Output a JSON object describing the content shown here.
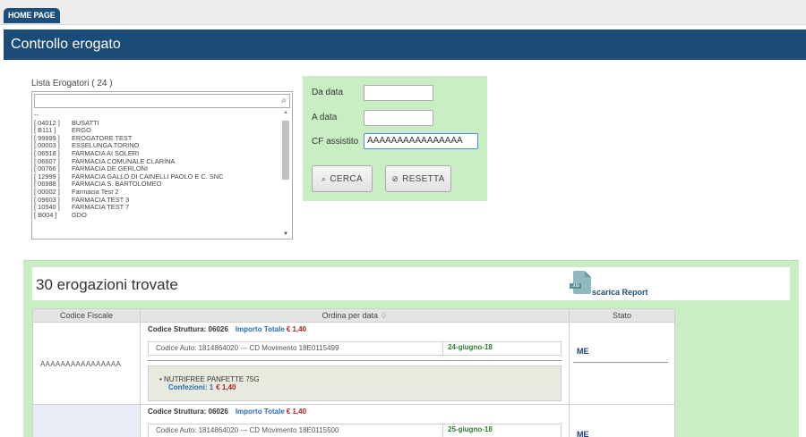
{
  "nav": {
    "home_tab": "HOME PAGE"
  },
  "page": {
    "title": "Controllo erogato"
  },
  "lista": {
    "label": "Lista Erogatori ( 24 )",
    "search_value": "",
    "items": [
      {
        "code": "--",
        "name": ""
      },
      {
        "code": "[ 04012 ]",
        "name": "BUSATTI"
      },
      {
        "code": "[ B111 ]",
        "name": "ERGO"
      },
      {
        "code": "[ 99999 ]",
        "name": "EROGATORE TEST"
      },
      {
        "code": "[ 00003 ]",
        "name": "ESSELUNGA TORINO"
      },
      {
        "code": "[ 06518 ]",
        "name": "FARMACIA AI SOLERI"
      },
      {
        "code": "[ 06607 ]",
        "name": "FARMACIA COMUNALE CLARINA"
      },
      {
        "code": "[ 00766 ]",
        "name": "FARMACIA DE GERLONI"
      },
      {
        "code": "[ 12999 ]",
        "name": "FARMACIA GALLO DI CAINELLI PAOLO E C. SNC"
      },
      {
        "code": "[ 06988 ]",
        "name": "FARMACIA S. BARTOLOMEO"
      },
      {
        "code": "[ 00002 ]",
        "name": "Farmacia Test 2"
      },
      {
        "code": "[ 09603 ]",
        "name": "FARMACIA TEST 3"
      },
      {
        "code": "[ 10540 ]",
        "name": "FARMACIA TEST 7"
      },
      {
        "code": "[ B004 ]",
        "name": "GDO"
      }
    ]
  },
  "filters": {
    "da_data_label": "Da data",
    "da_data_value": "",
    "a_data_label": "A data",
    "a_data_value": "",
    "cf_label": "CF assistito",
    "cf_value": "AAAAAAAAAAAAAAAA",
    "cerca_label": "CERCA",
    "resetta_label": "RESETTA"
  },
  "results": {
    "title": "30 erogazioni trovate",
    "file_badge": ".xls",
    "report_label": "scarica Report",
    "columns": [
      "Codice Fiscale",
      "Ordina per data ♢",
      "Stato"
    ],
    "rows": [
      {
        "codice_fiscale": "AAAAAAAAAAAAAAAA",
        "struttura": "Codice Struttura: 06026",
        "importo_label": "Importo Totale",
        "importo_value": "€ 1,40",
        "codice_auto": "Codice Auto: 1814864020 --- CD Movimento 18E0115499",
        "data": "24-giugno-18",
        "prodotto": "•  NUTRIFREE PANFETTE 75G",
        "confezioni_label": "Confezioni: 1",
        "confezioni_value": "€ 1,40",
        "stato": "ME"
      },
      {
        "codice_fiscale": "",
        "struttura": "Codice Struttura: 06026",
        "importo_label": "Importo Totale",
        "importo_value": "€ 1,40",
        "codice_auto": "Codice Auto: 1814864020 --- CD Movimento 18E0115500",
        "data": "25-giugno-18",
        "stato": "ME"
      }
    ]
  }
}
